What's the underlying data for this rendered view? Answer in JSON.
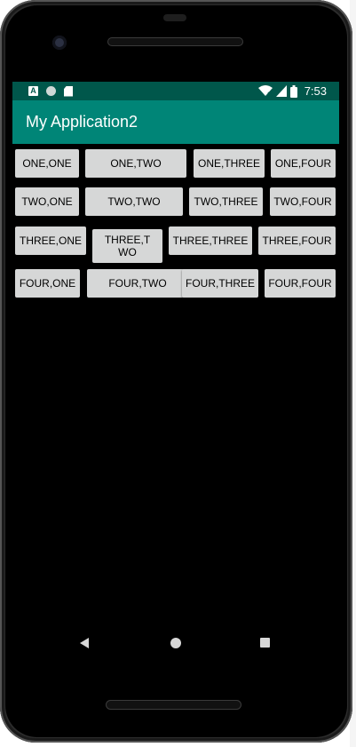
{
  "app": {
    "title": "My Application2"
  },
  "status_bar": {
    "time": "7:53",
    "left_icons": [
      "notification-a-icon",
      "circle-icon",
      "sd-card-icon"
    ],
    "notification_letter": "A",
    "right_icons": [
      "wifi-icon",
      "signal-icon",
      "battery-icon"
    ]
  },
  "buttons": [
    [
      "ONE,ONE",
      "ONE,TWO",
      "ONE,THREE",
      "ONE,FOUR"
    ],
    [
      "TWO,ONE",
      "TWO,TWO",
      "TWO,THREE",
      "TWO,FOUR"
    ],
    [
      "THREE,ONE",
      "THREE,TWO",
      "THREE,THREE",
      "THREE,FOUR"
    ],
    [
      "FOUR,ONE",
      "FOUR,TWO",
      "FOUR,THREE",
      "FOUR,FOUR"
    ]
  ],
  "navigation": {
    "icons": [
      "back-icon",
      "home-icon",
      "recents-icon"
    ]
  },
  "colors": {
    "status_bar": "#00574b",
    "app_bar": "#008577",
    "button": "#d6d7d7",
    "screen_background": "#000000"
  }
}
